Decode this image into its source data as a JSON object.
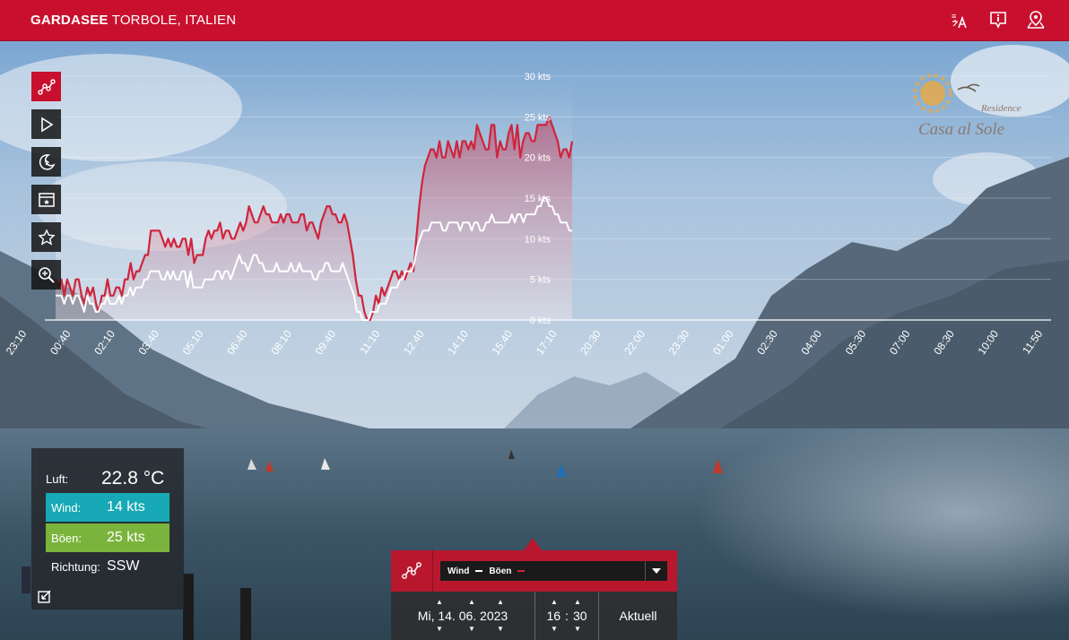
{
  "header": {
    "title_bold": "GARDASEE",
    "title_rest": " TORBOLE, ITALIEN",
    "icons": [
      "translate-icon",
      "info-icon",
      "map-pin-icon"
    ]
  },
  "tools": [
    "graph-icon",
    "play-icon",
    "moon-icon",
    "window-icon",
    "star-icon",
    "zoom-icon"
  ],
  "logo": {
    "line1": "Residence",
    "line2": "Casa al Sole"
  },
  "weather": {
    "air_label": "Luft:",
    "air_value": "22.8 °C",
    "wind_label": "Wind:",
    "wind_value": "14 kts",
    "gust_label": "Böen:",
    "gust_value": "25 kts",
    "dir_label": "Richtung:",
    "dir_value": "SSW"
  },
  "control": {
    "wind_label": "Wind",
    "gust_label": "Böen",
    "date": "Mi, 14. 06. 2023",
    "hour": "16",
    "minute": "30",
    "now_label": "Aktuell"
  },
  "colors": {
    "brand_red": "#c8102e",
    "wind_band": "#17a9b5",
    "gust_band": "#7ab43c",
    "gust_line": "#d0243c",
    "wind_line": "#ffffff"
  },
  "chart_data": {
    "type": "line",
    "y_unit": "kts",
    "ylim": [
      0,
      30
    ],
    "y_ticks": [
      "0 kts",
      "5 kts",
      "10 kts",
      "15 kts",
      "20 kts",
      "25 kts",
      "30 kts"
    ],
    "x_ticks": [
      "23:10",
      "00:40",
      "02:10",
      "03:40",
      "05:10",
      "06:40",
      "08:10",
      "09:40",
      "11:10",
      "12:40",
      "14:10",
      "15:40",
      "17:10",
      "20:30",
      "22:00",
      "23:30",
      "01:00",
      "02:30",
      "04:00",
      "05:30",
      "07:00",
      "08:30",
      "10:00",
      "11:50"
    ],
    "grid": true,
    "series": [
      {
        "name": "Böen",
        "values": [
          5,
          4,
          5,
          3,
          5,
          4,
          3,
          5,
          5,
          3,
          2,
          4,
          3,
          4,
          2,
          1,
          3,
          3,
          5,
          3,
          3,
          4,
          4,
          3,
          5,
          5,
          7,
          5,
          6,
          6,
          7,
          8,
          8,
          11,
          11,
          11,
          11,
          10,
          9,
          10,
          9,
          10,
          9,
          9,
          10,
          10,
          8,
          10,
          7,
          8,
          8,
          8,
          10,
          11,
          10,
          11,
          11,
          12,
          10,
          11,
          11,
          10,
          10,
          11,
          12,
          11,
          12,
          14,
          13,
          12,
          12,
          13,
          14,
          13,
          13,
          12,
          12,
          12,
          13,
          12,
          13,
          13,
          12,
          12,
          12,
          13,
          13,
          11,
          12,
          12,
          11,
          10,
          12,
          13,
          14,
          14,
          13,
          13,
          12,
          12,
          13,
          12,
          10,
          8,
          5,
          3,
          3,
          1,
          0,
          0,
          1,
          3,
          2,
          4,
          3,
          4,
          5,
          6,
          6,
          5,
          6,
          5,
          6,
          7,
          6,
          10,
          14,
          17,
          19,
          20,
          21,
          21,
          20,
          22,
          20,
          20,
          22,
          21,
          20,
          22,
          20,
          22,
          22,
          21,
          22,
          21,
          24,
          23,
          22,
          21,
          21,
          24,
          24,
          20,
          22,
          21,
          21,
          23,
          24,
          21,
          24,
          20,
          22,
          23,
          23,
          22,
          22,
          24,
          24,
          24,
          24,
          25,
          24,
          23,
          22,
          20,
          21,
          21,
          20,
          22
        ]
      },
      {
        "name": "Wind",
        "values": [
          3,
          3,
          3,
          2,
          3,
          3,
          2,
          3,
          3,
          2,
          1,
          3,
          2,
          2,
          1,
          1,
          2,
          2,
          3,
          2,
          2,
          2,
          3,
          2,
          3,
          3,
          4,
          3,
          4,
          4,
          4,
          5,
          5,
          6,
          6,
          6,
          6,
          5,
          5,
          6,
          5,
          6,
          5,
          5,
          6,
          6,
          4,
          6,
          4,
          4,
          4,
          4,
          5,
          5,
          5,
          5,
          6,
          6,
          5,
          6,
          6,
          5,
          6,
          7,
          8,
          7,
          7,
          6,
          7,
          8,
          8,
          7,
          7,
          6,
          6,
          6,
          6,
          7,
          6,
          6,
          6,
          6,
          7,
          6,
          6,
          7,
          6,
          6,
          6,
          6,
          5,
          5,
          6,
          6,
          7,
          7,
          6,
          6,
          6,
          6,
          7,
          6,
          5,
          4,
          3,
          1,
          1,
          0,
          0,
          0,
          1,
          1,
          1,
          2,
          2,
          2,
          3,
          4,
          4,
          4,
          5,
          5,
          6,
          6,
          6,
          7,
          9,
          10,
          11,
          11,
          11,
          12,
          12,
          12,
          12,
          11,
          11,
          12,
          12,
          12,
          12,
          11,
          12,
          12,
          12,
          11,
          12,
          12,
          11,
          11,
          12,
          12,
          13,
          12,
          12,
          12,
          12,
          12,
          12,
          13,
          12,
          13,
          13,
          12,
          13,
          13,
          13,
          13,
          14,
          14,
          15,
          15,
          14,
          14,
          13,
          13,
          12,
          12,
          12,
          11,
          11
        ]
      }
    ]
  }
}
